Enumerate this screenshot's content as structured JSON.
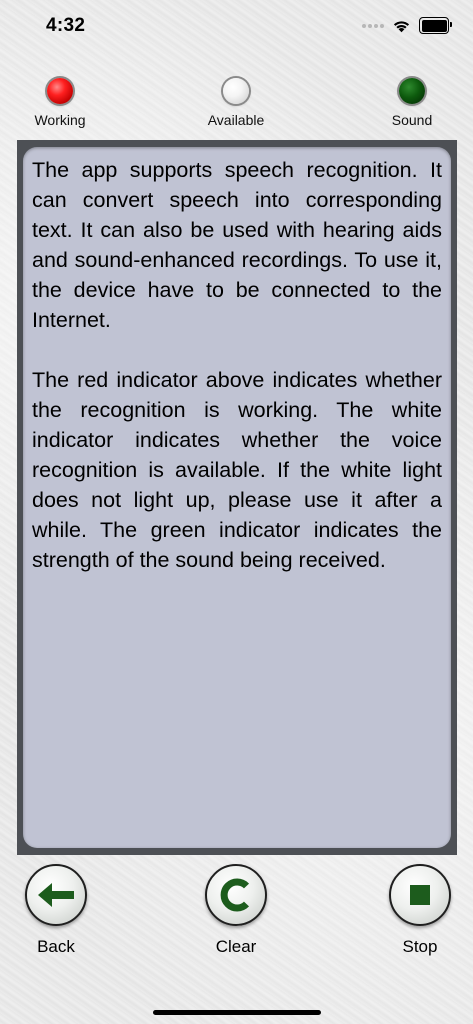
{
  "status_bar": {
    "time": "4:32",
    "icons": [
      "cellular-dots-icon",
      "wifi-icon",
      "battery-icon"
    ]
  },
  "indicators": [
    {
      "label": "Working",
      "state": "red-on",
      "color": "#e01414"
    },
    {
      "label": "Available",
      "state": "white-off",
      "color": "#ececec"
    },
    {
      "label": "Sound",
      "state": "green-dim",
      "color": "#0b4f0b"
    }
  ],
  "panel": {
    "paragraphs": [
      "The app supports speech recognition. It can convert speech into corresponding text. It can also be used with hearing aids and sound-enhanced recordings. To use it, the device have to be connected to the Internet.",
      "The red indicator above indicates whether the recognition is working. The white indicator indicates whether the voice recognition is available. If the white light does not light up, please use it after a while. The green indicator indicates the strength of the sound being received."
    ],
    "frame_color": "#4d5055",
    "background_color": "#c0c3d3"
  },
  "buttons": {
    "back": {
      "label": "Back",
      "icon": "arrow-left-icon"
    },
    "clear": {
      "label": "Clear",
      "icon": "letter-c-icon"
    },
    "stop": {
      "label": "Stop",
      "icon": "stop-square-icon"
    }
  },
  "accent_color": "#1d5c1d"
}
